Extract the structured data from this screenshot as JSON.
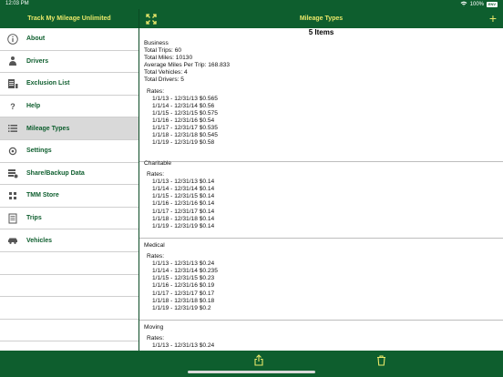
{
  "status": {
    "time": "12:03 PM",
    "battery_pct": "100%",
    "battery_label": "ENV"
  },
  "sidebar": {
    "title": "Track My Mileage Unlimited",
    "items": [
      {
        "label": "About",
        "icon": "info-icon"
      },
      {
        "label": "Drivers",
        "icon": "driver-icon"
      },
      {
        "label": "Exclusion List",
        "icon": "exclusion-list-icon"
      },
      {
        "label": "Help",
        "icon": "help-icon"
      },
      {
        "label": "Mileage Types",
        "icon": "list-icon",
        "active": true
      },
      {
        "label": "Settings",
        "icon": "settings-icon"
      },
      {
        "label": "Share/Backup Data",
        "icon": "share-backup-icon"
      },
      {
        "label": "TMM Store",
        "icon": "store-icon"
      },
      {
        "label": "Trips",
        "icon": "trips-icon"
      },
      {
        "label": "Vehicles",
        "icon": "car-icon"
      }
    ]
  },
  "main": {
    "title": "Mileage Types",
    "count": "5 Items",
    "sections": [
      {
        "name": "Business",
        "stats": [
          "Total Trips: 60",
          "Total Miles: 10130",
          "Average Miles Per Trip: 168.833",
          "Total Vehicles: 4",
          "Total Drivers: 5"
        ],
        "rates_label": "Rates:",
        "rates": [
          "1/1/13 - 12/31/13 $0.565",
          "1/1/14 - 12/31/14 $0.56",
          "1/1/15 - 12/31/15 $0.575",
          "1/1/16 - 12/31/16 $0.54",
          "1/1/17 - 12/31/17 $0.535",
          "1/1/18 - 12/31/18 $0.545",
          "1/1/19 - 12/31/19 $0.58"
        ]
      },
      {
        "name": "Charitable",
        "stats": [],
        "rates_label": "Rates:",
        "rates": [
          "1/1/13 - 12/31/13 $0.14",
          "1/1/14 - 12/31/14 $0.14",
          "1/1/15 - 12/31/15 $0.14",
          "1/1/16 - 12/31/16 $0.14",
          "1/1/17 - 12/31/17 $0.14",
          "1/1/18 - 12/31/18 $0.14",
          "1/1/19 - 12/31/19 $0.14"
        ]
      },
      {
        "name": "Medical",
        "stats": [],
        "rates_label": "Rates:",
        "rates": [
          "1/1/13 - 12/31/13 $0.24",
          "1/1/14 - 12/31/14 $0.235",
          "1/1/15 - 12/31/15 $0.23",
          "1/1/16 - 12/31/16 $0.19",
          "1/1/17 - 12/31/17 $0.17",
          "1/1/18 - 12/31/18 $0.18",
          "1/1/19 - 12/31/19 $0.2"
        ]
      },
      {
        "name": "Moving",
        "stats": [],
        "rates_label": "Rates:",
        "rates": [
          "1/1/13 - 12/31/13 $0.24"
        ]
      }
    ]
  },
  "colors": {
    "bar": "#0e5e2e",
    "title": "#e9e86a",
    "label": "#0e5e2e"
  }
}
